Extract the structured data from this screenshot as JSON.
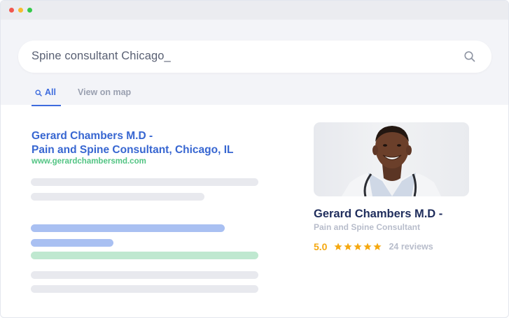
{
  "window": {
    "traffic_lights": [
      "#f1574e",
      "#f7bc2f",
      "#35c94a"
    ]
  },
  "search": {
    "query": "Spine consultant Chicago_",
    "icon": "search-icon"
  },
  "tabs": [
    {
      "label": "All",
      "icon": "search-icon",
      "active": true
    },
    {
      "label": "View on map",
      "active": false
    }
  ],
  "result": {
    "title_line1": "Gerard Chambers M.D -",
    "title_line2": "Pain and Spine Consultant, Chicago, IL",
    "url": "www.gerardchambersmd.com"
  },
  "profile_card": {
    "photo": "doctor-photo",
    "name": "Gerard Chambers M.D -",
    "subtitle": "Pain and Spine Consultant",
    "rating": "5.0",
    "stars": 5,
    "reviews": "24 reviews"
  },
  "colors": {
    "accent": "#3d6bde",
    "link": "#3766d1",
    "url_green": "#52c483",
    "star": "#f5a80f",
    "placeholder_gray": "#e8e9ee",
    "placeholder_blue": "#a9c0f2",
    "placeholder_green": "#bfe8d0"
  }
}
